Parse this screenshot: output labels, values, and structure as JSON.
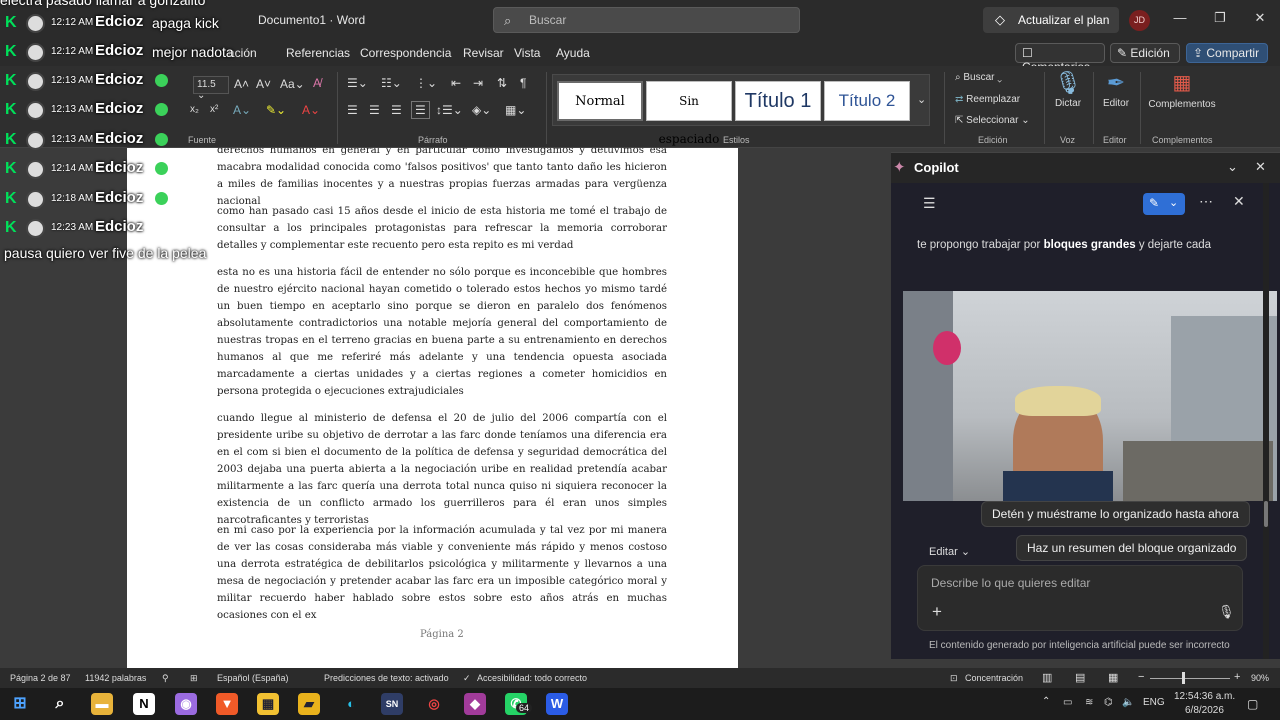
{
  "window": {
    "title": "Documento1 · Word",
    "search_placeholder": "Buscar",
    "upgrade_label": "Actualizar el plan",
    "avatar_initials": "JD"
  },
  "menu": [
    "Referencias",
    "Correspondencia",
    "Revisar",
    "Vista",
    "Ayuda"
  ],
  "menu_partial": "ación",
  "toolbar": {
    "comments": "Comentarios",
    "editing": "Edición",
    "share": "Compartir"
  },
  "ribbon": {
    "font_size": "11.5",
    "groups": {
      "fuente": "Fuente",
      "parrafo": "Párrafo",
      "estilos": "Estilos",
      "edicion": "Edición",
      "voz": "Voz",
      "editor": "Editor",
      "complementos": "Complementos"
    },
    "styles": [
      "Normal",
      "Sin espaciado",
      "Título 1",
      "Título 2"
    ],
    "edit_buttons": {
      "find": "Buscar",
      "replace": "Reemplazar",
      "select": "Seleccionar"
    },
    "big_buttons": {
      "dictate": "Dictar",
      "editor": "Editor",
      "addins": "Complementos"
    }
  },
  "document": {
    "paragraphs": [
      "derechos humanos en general y en particular como investigamos y detuvimos esa macabra modalidad conocida como 'falsos positivos' que tanto tanto daño les hicieron a miles de familias inocentes y a nuestras propias fuerzas armadas para vergüenza nacional",
      "como han pasado casi 15 años desde el inicio de esta historia me tomé el trabajo de consultar a los principales protagonistas para refrescar la memoria corroborar detalles y complementar este recuento pero esta repito es mi verdad",
      "esta no es una historia fácil de entender no sólo porque es inconcebible que hombres de nuestro ejército nacional hayan cometido o tolerado estos hechos yo mismo tardé un buen tiempo en aceptarlo sino porque se dieron en paralelo dos fenómenos absolutamente contradictorios una notable mejoría general del comportamiento de nuestras tropas en el terreno gracias en buena parte a su entrenamiento en derechos humanos al que me referiré más adelante y una tendencia opuesta asociada marcadamente a ciertas unidades y a ciertas regiones a cometer homicidios en persona protegida o ejecuciones extrajudiciales",
      "cuando llegue al ministerio de defensa el 20 de julio del 2006 compartía con el presidente uribe su objetivo de derrotar a las farc donde teníamos una diferencia era en el com si bien el documento de la política de defensa y seguridad democrática del 2003 dejaba una puerta abierta a la negociación uribe en realidad pretendía acabar militarmente a las farc quería una derrota total nunca quiso ni siquiera reconocer la existencia de un conflicto armado los guerrilleros para él eran unos simples narcotraficantes y terroristas",
      "en mi caso por la experiencia por la información acumulada y tal vez por mi manera de ver las cosas consideraba más viable y conveniente más rápido y menos costoso una derrota estratégica de debilitarlos psicológica y militarmente y llevarnos a una mesa de negociación y pretender acabar las farc era un imposible categórico moral y militar recuerdo haber hablado sobre estos sobre esto años atrás en muchas ocasiones con el ex"
    ],
    "page_label": "Página 2"
  },
  "copilot": {
    "title": "Copilot",
    "intro_text": "te propongo trabajar por bloques grandes y dejarte cada",
    "intro_bold": "bloques grandes",
    "chips": [
      "Detén y muéstrame lo organizado hasta ahora",
      "Haz un resumen del bloque organizado"
    ],
    "edit_label": "Editar",
    "input_placeholder": "Describe lo que quieres editar",
    "disclaimer": "El contenido generado por inteligencia artificial puede ser incorrecto"
  },
  "status": {
    "page": "Página 2 de 87",
    "words": "11942 palabras",
    "language": "Español (España)",
    "predictions": "Predicciones de texto: activado",
    "accessibility": "Accesibilidad: todo correcto",
    "focus": "Concentración",
    "zoom": "90%"
  },
  "taskbar": {
    "badge": "64",
    "lang": "ENG",
    "time": "12:54:36 a.m.",
    "date": "6/8/2026"
  },
  "chat": {
    "top_text": "electra pasado llamar a gonzalito",
    "messages": [
      {
        "time": "12:12 AM",
        "user": "Edcioz",
        "msg": "apaga kick"
      },
      {
        "time": "12:12 AM",
        "user": "Edcioz",
        "msg": "mejor nadota"
      },
      {
        "time": "12:13 AM",
        "user": "Edcioz",
        "msg": ""
      },
      {
        "time": "12:13 AM",
        "user": "Edcioz",
        "msg": ""
      },
      {
        "time": "12:13 AM",
        "user": "Edcioz",
        "msg": ""
      },
      {
        "time": "12:14 AM",
        "user": "Edcioz",
        "msg": ""
      },
      {
        "time": "12:18 AM",
        "user": "Edcioz",
        "msg": ""
      },
      {
        "time": "12:23 AM",
        "user": "Edcioz",
        "msg": ""
      }
    ],
    "bottom_text": "pausa quiero ver five de la pelea"
  }
}
